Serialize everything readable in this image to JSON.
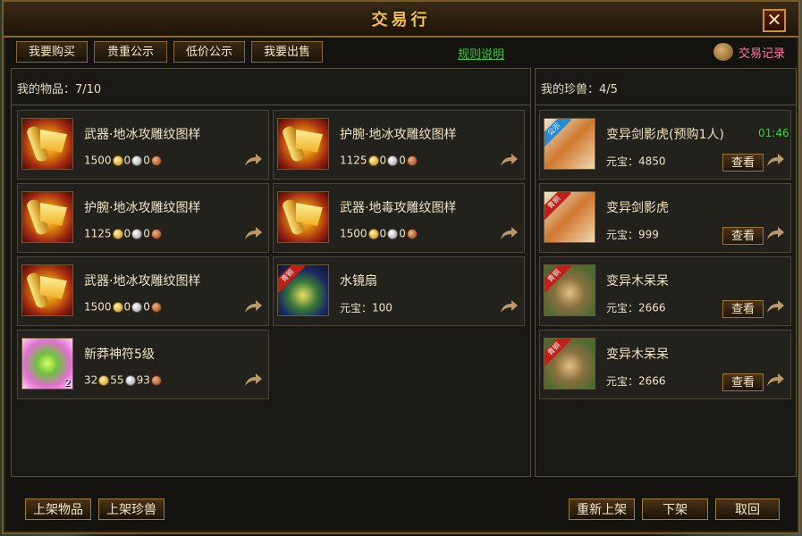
{
  "window": {
    "title": "交易行",
    "close_label": "✕"
  },
  "tabs": [
    {
      "label": "我要购买"
    },
    {
      "label": "贵重公示"
    },
    {
      "label": "低价公示"
    },
    {
      "label": "我要出售"
    }
  ],
  "rules_link": "规则说明",
  "trade_log": "交易记录",
  "items_panel": {
    "header": "我的物品：7/10",
    "items": [
      {
        "name": "武器·地冰攻雕纹图样",
        "gold": "1500",
        "silver": "0",
        "copper": "0",
        "icon": "scroll-icon"
      },
      {
        "name": "护腕·地冰攻雕纹图样",
        "gold": "1125",
        "silver": "0",
        "copper": "0",
        "icon": "scroll-icon"
      },
      {
        "name": "护腕·地冰攻雕纹图样",
        "gold": "1125",
        "silver": "0",
        "copper": "0",
        "icon": "scroll-icon"
      },
      {
        "name": "武器·地毒攻雕纹图样",
        "gold": "1500",
        "silver": "0",
        "copper": "0",
        "icon": "scroll-icon"
      },
      {
        "name": "武器·地冰攻雕纹图样",
        "gold": "1500",
        "silver": "0",
        "copper": "0",
        "icon": "scroll-icon"
      },
      {
        "name": "水镜扇",
        "yuanbao_label": "元宝：",
        "yuanbao": "100",
        "icon": "fan-icon",
        "ribbon": "青铜"
      },
      {
        "name": "新莽神符5级",
        "gold": "32",
        "silver": "55",
        "copper": "93",
        "qty": "2",
        "icon": "talisman-icon"
      }
    ]
  },
  "pets_panel": {
    "header": "我的珍兽：4/5",
    "pets": [
      {
        "name": "变异剑影虎(预购1人)",
        "yuanbao_label": "元宝：",
        "yuanbao": "4850",
        "timer": "01:46",
        "ribbon": "公示",
        "view_label": "查看",
        "icon": "tiger-icon"
      },
      {
        "name": "变异剑影虎",
        "yuanbao_label": "元宝：",
        "yuanbao": "999",
        "ribbon": "青铜",
        "view_label": "查看",
        "icon": "tiger-icon"
      },
      {
        "name": "变异木呆呆",
        "yuanbao_label": "元宝：",
        "yuanbao": "2666",
        "ribbon": "青铜",
        "view_label": "查看",
        "icon": "wood-icon"
      },
      {
        "name": "变异木呆呆",
        "yuanbao_label": "元宝：",
        "yuanbao": "2666",
        "ribbon": "青铜",
        "view_label": "查看",
        "icon": "wood-icon"
      }
    ]
  },
  "bottom_buttons": {
    "list_item": "上架物品",
    "list_pet": "上架珍兽",
    "relist": "重新上架",
    "delist": "下架",
    "retrieve": "取回"
  },
  "colors": {
    "title": "#f0c050",
    "rules_link": "#38c838",
    "trade_log": "#ff7aa8",
    "timer": "#38d038",
    "frame_border": "#7a5a28"
  }
}
